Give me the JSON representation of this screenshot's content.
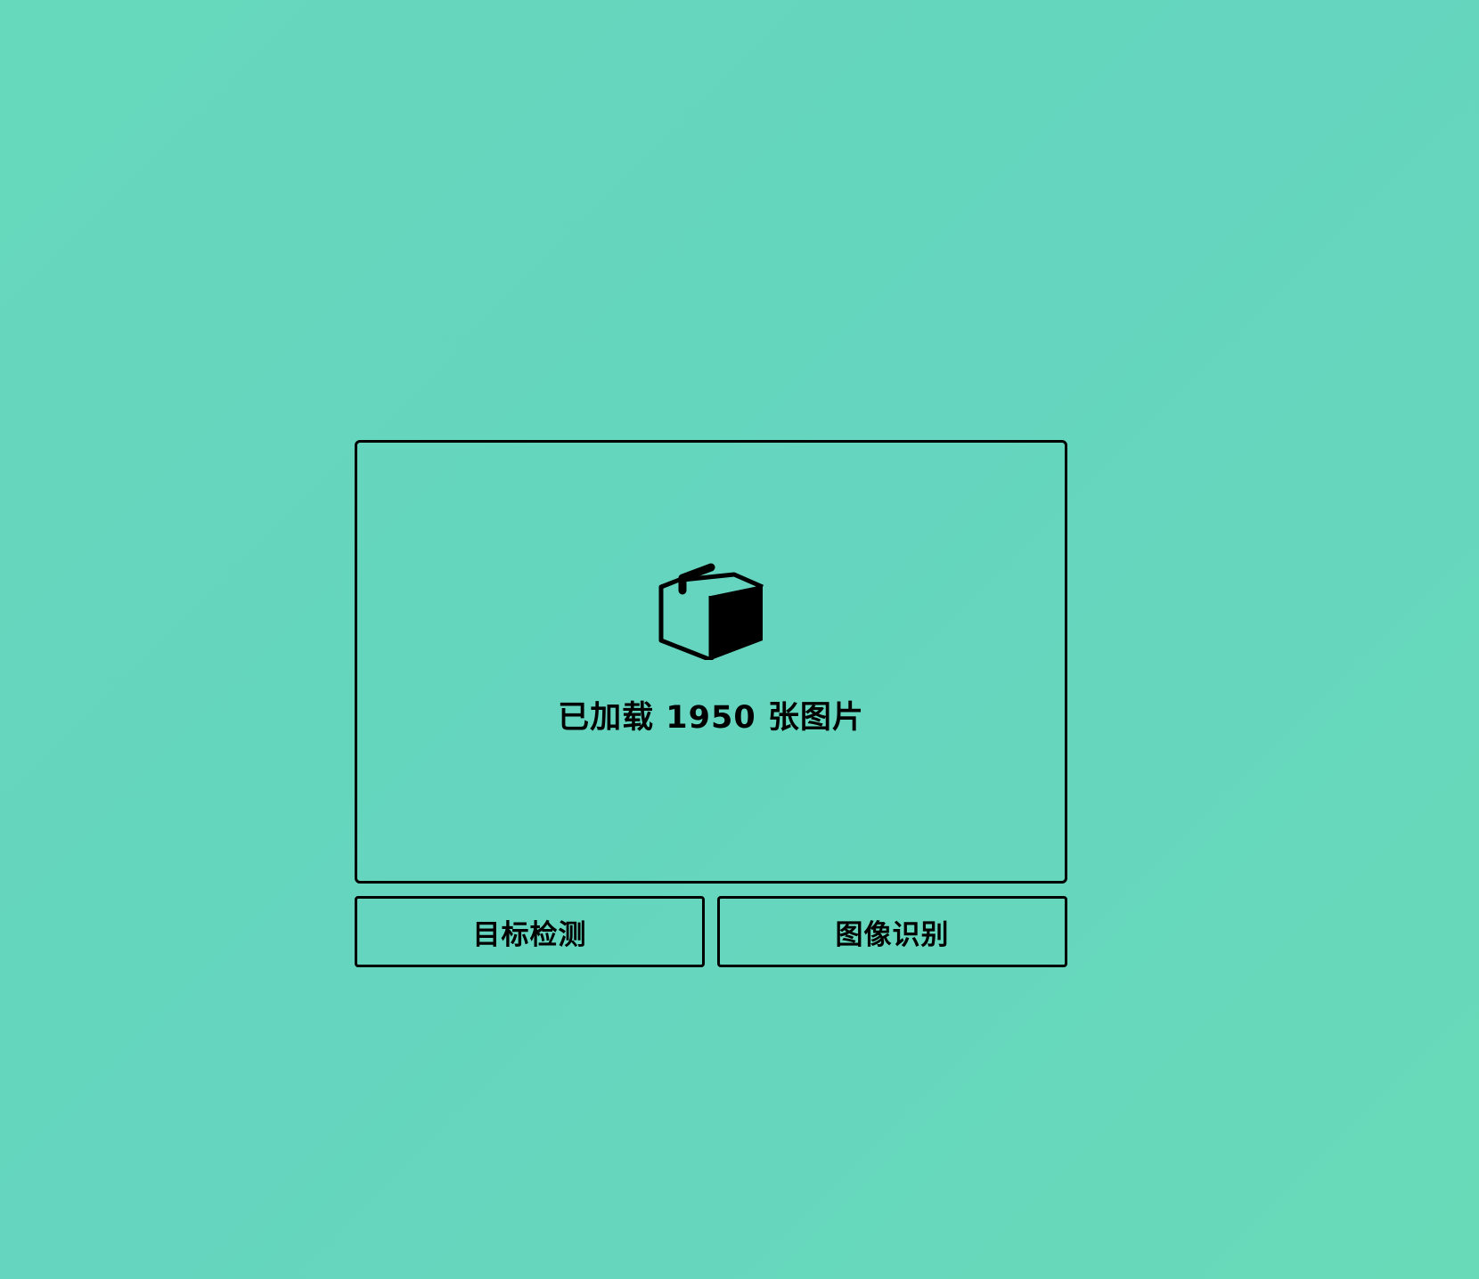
{
  "colors": {
    "background": "#66d8bc",
    "foreground": "#000000"
  },
  "upload_area": {
    "icon": "box-icon",
    "status": "已加载 1950 张图片"
  },
  "actions": {
    "detect_label": "目标检测",
    "recognize_label": "图像识别"
  }
}
